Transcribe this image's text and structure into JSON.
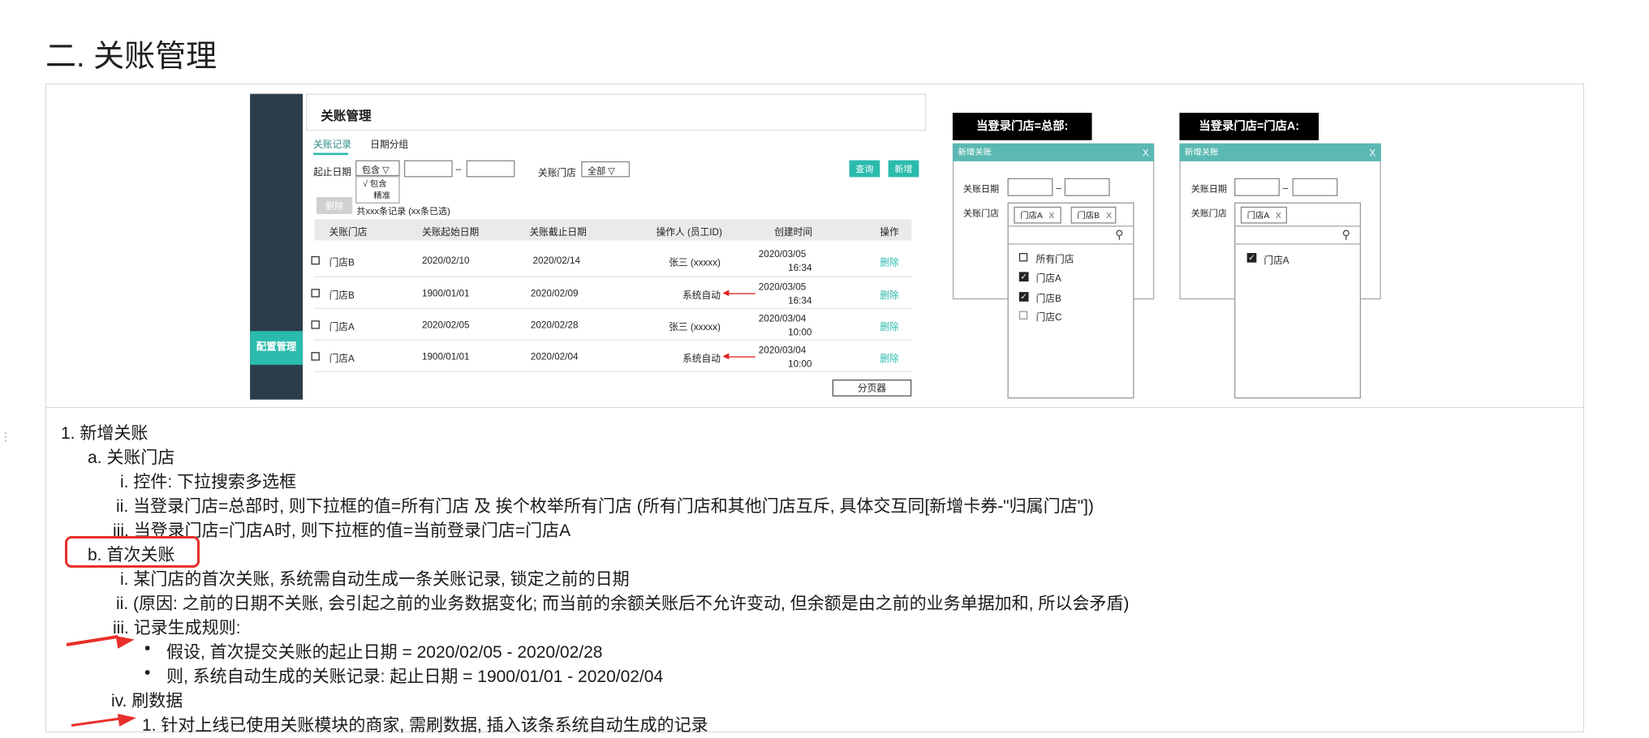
{
  "heading": "二. 关账管理",
  "mockup": {
    "sidebar_item": "配置管理",
    "panel_title": "关账管理",
    "tabs": [
      "关账记录",
      "日期分组"
    ],
    "filter": {
      "date_label": "起止日期",
      "mode_select": "包含 ▽",
      "mode_options": [
        "√ 包含",
        "精准"
      ],
      "range_sep": "–",
      "store_label": "关账门店",
      "store_select": "全部 ▽",
      "query_btn": "查询",
      "add_btn": "新增"
    },
    "delete_btn": "删除",
    "record_count": "共xxx条记录 (xx条已选)",
    "columns": [
      "关账门店",
      "关账起始日期",
      "关账截止日期",
      "操作人 (员工ID)",
      "创建时间",
      "操作"
    ],
    "rows": [
      {
        "store": "门店B",
        "start": "2020/02/10",
        "end": "2020/02/14",
        "operator": "张三 (xxxxx)",
        "date": "2020/03/05",
        "time": "16:34",
        "action": "删除"
      },
      {
        "store": "门店B",
        "start": "1900/01/01",
        "end": "2020/02/09",
        "operator": "系统自动",
        "date": "2020/03/05",
        "time": "16:34",
        "action": "删除"
      },
      {
        "store": "门店A",
        "start": "2020/02/05",
        "end": "2020/02/28",
        "operator": "张三 (xxxxx)",
        "date": "2020/03/04",
        "time": "10:00",
        "action": "删除"
      },
      {
        "store": "门店A",
        "start": "1900/01/01",
        "end": "2020/02/04",
        "operator": "系统自动",
        "date": "2020/03/04",
        "time": "10:00",
        "action": "删除"
      }
    ],
    "pager": "分页器",
    "hq": {
      "label": "当登录门店=总部:",
      "dialog_title": "新增关账",
      "close": "X",
      "date_label": "关账日期",
      "range_sep": "–",
      "store_label": "关账门店",
      "chips": [
        "门店A",
        "门店B"
      ],
      "chip_x": "X",
      "search_icon": "⚲",
      "options": [
        {
          "label": "所有门店",
          "checked": false
        },
        {
          "label": "门店A",
          "checked": true
        },
        {
          "label": "门店B",
          "checked": true
        },
        {
          "label": "门店C",
          "checked": false
        }
      ]
    },
    "store": {
      "label": "当登录门店=门店A:",
      "dialog_title": "新增关账",
      "close": "X",
      "date_label": "关账日期",
      "range_sep": "–",
      "store_label": "关账门店",
      "chips": [
        "门店A"
      ],
      "chip_x": "X",
      "search_icon": "⚲",
      "options": [
        {
          "label": "门店A",
          "checked": true
        }
      ]
    }
  },
  "list": [
    "1.  新增关账",
    "a.  关账门店",
    "i.  控件: 下拉搜索多选框",
    "ii.  当登录门店=总部时, 则下拉框的值=所有门店 及 挨个枚举所有门店 (所有门店和其他门店互斥, 具体交互同[新增卡券-\"归属门店\"])",
    "iii.  当登录门店=门店A时, 则下拉框的值=当前登录门店=门店A",
    "b.  首次关账",
    "i.  某门店的首次关账, 系统需自动生成一条关账记录, 锁定之前的日期",
    "ii.  (原因: 之前的日期不关账, 会引起之前的业务数据变化; 而当前的余额关账后不允许变动, 但余额是由之前的业务单据加和, 所以会矛盾)",
    "iii.  记录生成规则:",
    "假设, 首次提交关账的起止日期 = 2020/02/05 - 2020/02/28",
    "则, 系统自动生成的关账记录: 起止日期 = 1900/01/01 - 2020/02/04",
    "iv.  刷数据",
    "1.  针对上线已使用关账模块的商家, 需刷数据, 插入该条系统自动生成的记录"
  ],
  "bullet": "•",
  "drag_handle": "⋮",
  "colors": {
    "accent": "#2bbbad",
    "sidebar": "#2c3e4c",
    "annotation": "#e8302a"
  }
}
